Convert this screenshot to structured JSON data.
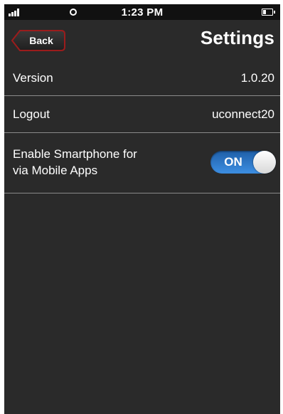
{
  "status_bar": {
    "time": "1:23 PM"
  },
  "nav": {
    "back_label": "Back",
    "title": "Settings"
  },
  "rows": [
    {
      "label": "Version",
      "value": "1.0.20"
    },
    {
      "label": "Logout",
      "value": "uconnect20"
    },
    {
      "label_line1": "Enable Smartphone for",
      "label_line2": "via Mobile Apps",
      "toggle_label": "ON",
      "toggle_on": true
    }
  ],
  "colors": {
    "background": "#2a2a2a",
    "status_bar": "#111111",
    "back_button_border": "#9b1c1c",
    "toggle_on": "#3d8fe3",
    "divider": "#8a8a8a"
  },
  "icons": [
    "signal-icon",
    "wifi-icon",
    "battery-icon"
  ]
}
